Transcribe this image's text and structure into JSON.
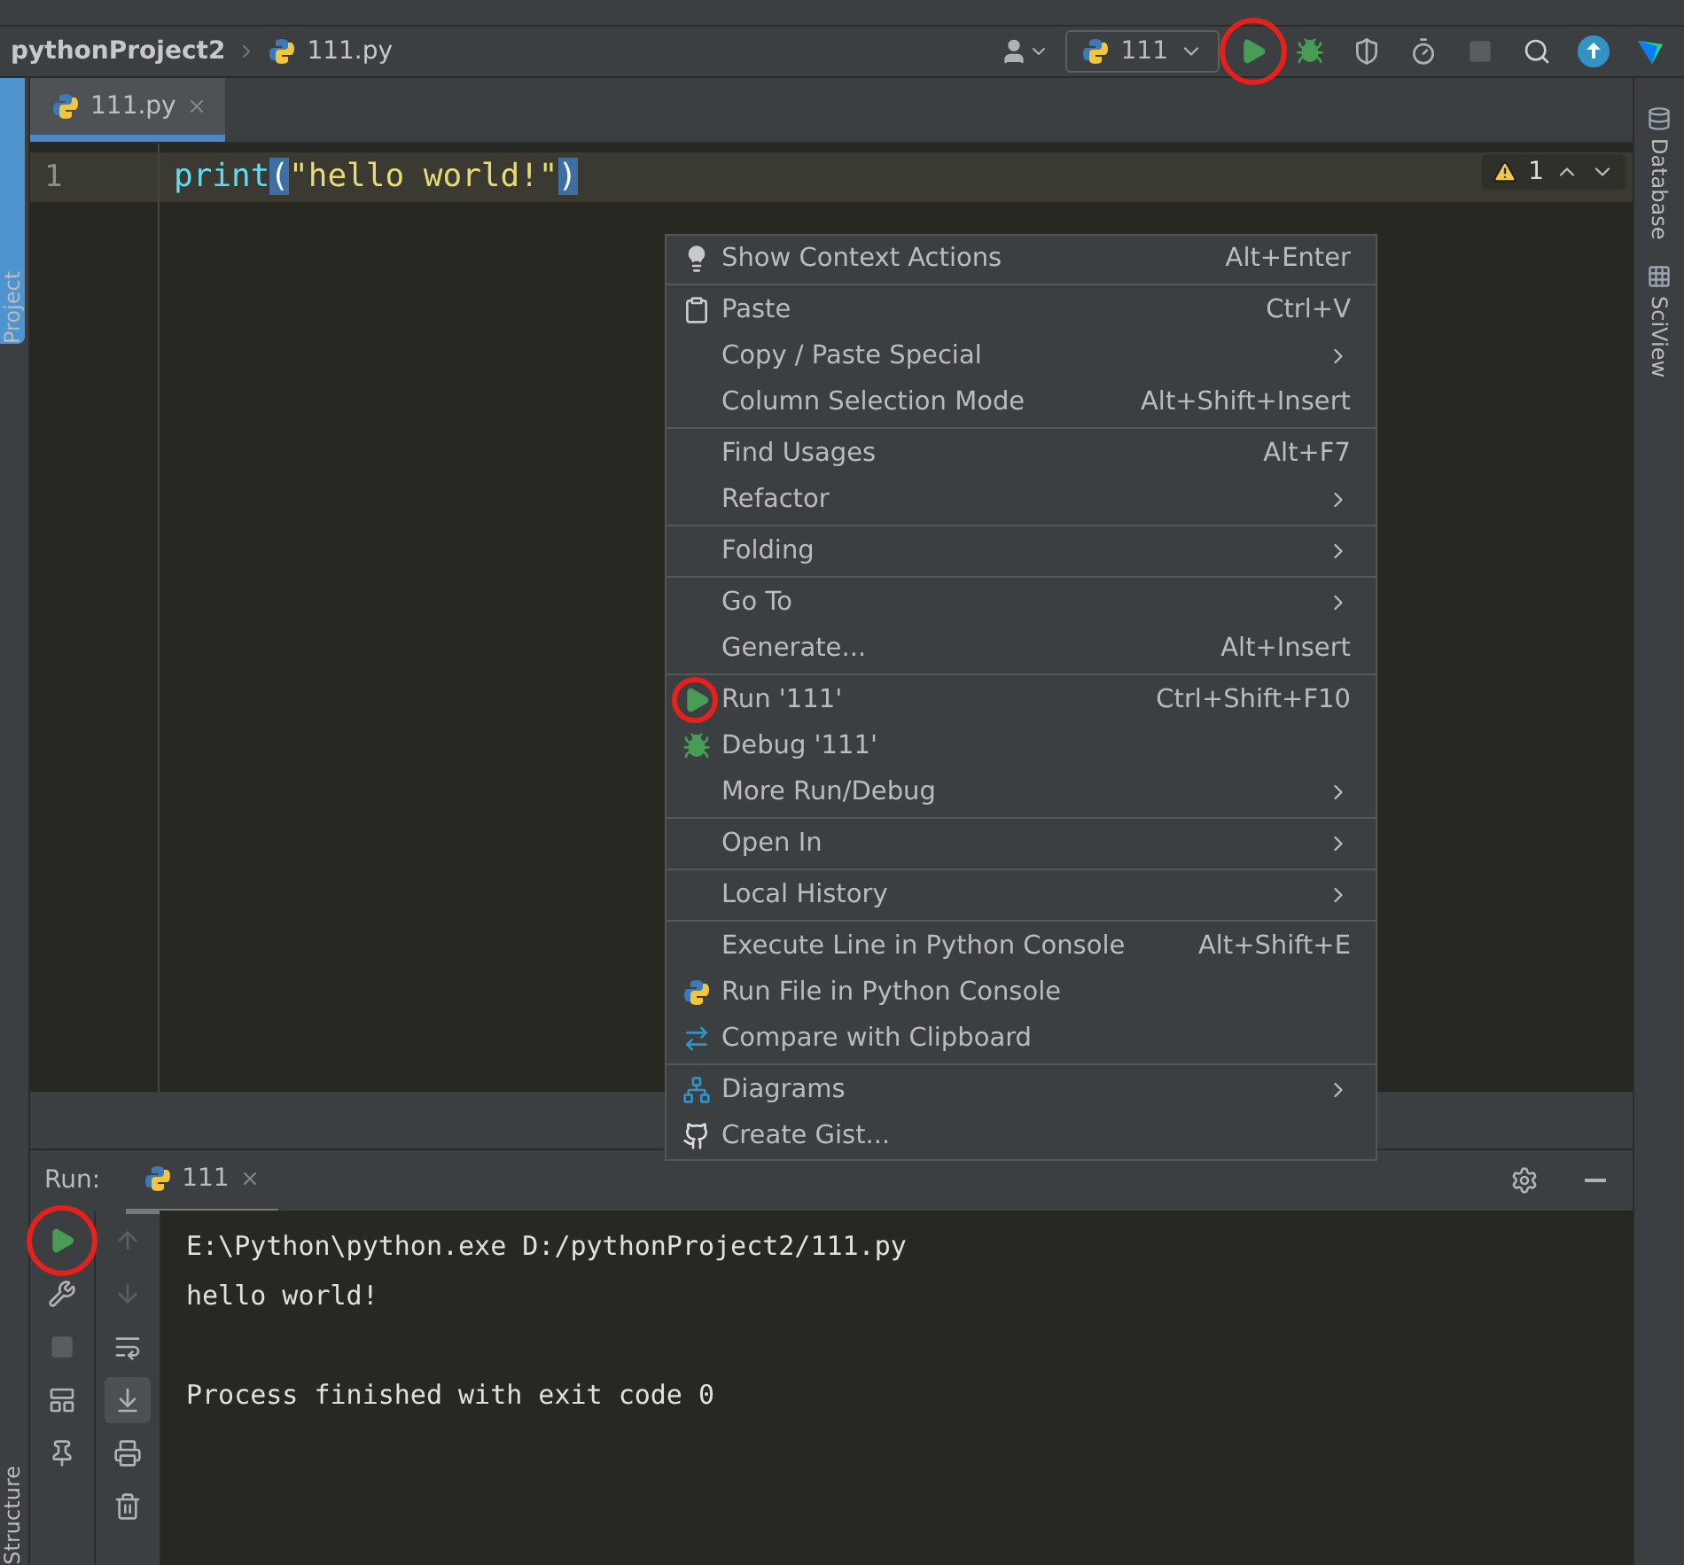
{
  "navbar": {
    "project": "pythonProject2",
    "file": "111.py"
  },
  "toolbar": {
    "run_config": "111",
    "run_button": {
      "circled": true
    }
  },
  "left_strip": {
    "label": "Project"
  },
  "right_strip": [
    {
      "label": "Database"
    },
    {
      "label": "SciView"
    }
  ],
  "editor_tabs": [
    {
      "label": "111.py",
      "selected": true
    }
  ],
  "editor": {
    "lines": [
      {
        "number": "1",
        "current": true,
        "tokens": [
          {
            "text": "print",
            "kind": "function"
          },
          {
            "text": "(",
            "kind": "brace"
          },
          {
            "text": "\"hello world!\"",
            "kind": "string"
          },
          {
            "text": ")",
            "kind": "brace"
          }
        ]
      }
    ],
    "warnings": "1"
  },
  "context_menu": {
    "groups": [
      [
        {
          "kind": "hint",
          "label": "Show Context Actions",
          "shortcut": "Alt+Enter",
          "submenu": false,
          "circled": false
        }
      ],
      [
        {
          "kind": "paste",
          "label": "Paste",
          "shortcut": "Ctrl+V",
          "submenu": false,
          "circled": false
        },
        {
          "kind": "plain",
          "label": "Copy / Paste Special",
          "submenu": true,
          "circled": false
        },
        {
          "kind": "plain",
          "label": "Column Selection Mode",
          "shortcut": "Alt+Shift+Insert",
          "submenu": false,
          "circled": false
        }
      ],
      [
        {
          "kind": "plain",
          "label": "Find Usages",
          "shortcut": "Alt+F7",
          "submenu": false,
          "circled": false
        },
        {
          "kind": "plain",
          "label": "Refactor",
          "submenu": true,
          "circled": false
        }
      ],
      [
        {
          "kind": "plain",
          "label": "Folding",
          "submenu": true,
          "circled": false
        }
      ],
      [
        {
          "kind": "plain",
          "label": "Go To",
          "submenu": true,
          "circled": false
        },
        {
          "kind": "plain",
          "label": "Generate...",
          "shortcut": "Alt+Insert",
          "submenu": false,
          "circled": false
        }
      ],
      [
        {
          "kind": "run",
          "label": "Run '111'",
          "shortcut": "Ctrl+Shift+F10",
          "submenu": false,
          "circled": true
        },
        {
          "kind": "debug",
          "label": "Debug '111'",
          "submenu": false,
          "circled": false
        },
        {
          "kind": "plain",
          "label": "More Run/Debug",
          "submenu": true,
          "circled": false
        }
      ],
      [
        {
          "kind": "plain",
          "label": "Open In",
          "submenu": true,
          "circled": false
        }
      ],
      [
        {
          "kind": "plain",
          "label": "Local History",
          "submenu": true,
          "circled": false
        }
      ],
      [
        {
          "kind": "plain",
          "label": "Execute Line in Python Console",
          "shortcut": "Alt+Shift+E",
          "submenu": false,
          "circled": false
        },
        {
          "kind": "python",
          "label": "Run File in Python Console",
          "submenu": false,
          "circled": false
        },
        {
          "kind": "compare",
          "label": "Compare with Clipboard",
          "submenu": false,
          "circled": false
        }
      ],
      [
        {
          "kind": "diagram",
          "label": "Diagrams",
          "submenu": true,
          "circled": false
        },
        {
          "kind": "github",
          "label": "Create Gist...",
          "submenu": false,
          "circled": false
        }
      ]
    ]
  },
  "run_panel": {
    "title": "Run:",
    "tabs": [
      {
        "label": "111",
        "selected": true
      }
    ],
    "rerun_button": {
      "circled": true
    },
    "console": [
      [
        "E:\\Python\\python.exe D:/pythonProject2/111.py",
        "hello world!"
      ],
      [
        "Process finished with exit code 0"
      ]
    ]
  },
  "bottom_strip": {
    "label": "Structure"
  }
}
